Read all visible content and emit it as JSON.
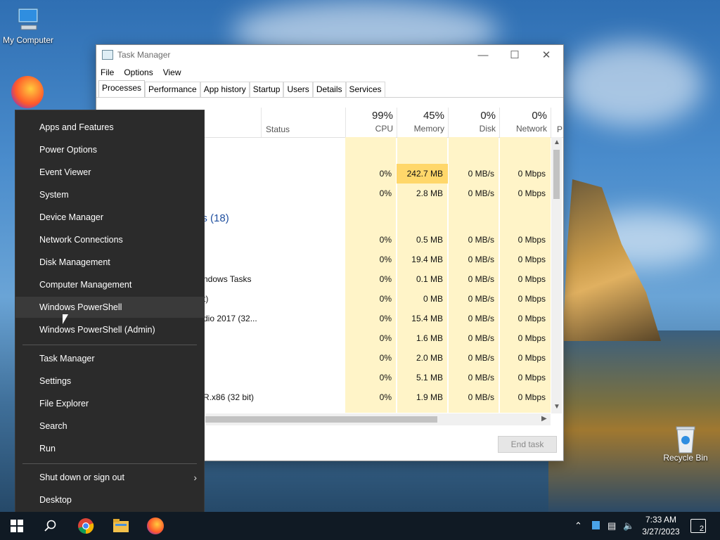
{
  "desktop": {
    "icons": [
      {
        "label": "My Computer"
      },
      {
        "label": "Recycle Bin"
      }
    ]
  },
  "task_manager": {
    "title": "Task Manager",
    "menu": [
      "File",
      "Options",
      "View"
    ],
    "tabs": [
      "Processes",
      "Performance",
      "App history",
      "Startup",
      "Users",
      "Details",
      "Services"
    ],
    "active_tab": "Processes",
    "columns": {
      "status": "Status",
      "cpu": {
        "pct": "99%",
        "label": "CPU"
      },
      "memory": {
        "pct": "45%",
        "label": "Memory"
      },
      "disk": {
        "pct": "0%",
        "label": "Disk"
      },
      "network": {
        "pct": "0%",
        "label": "Network"
      },
      "power_partial": "P"
    },
    "group_label_partial": "es (18)",
    "rows": [
      {
        "name": "",
        "cpu": "0%",
        "memory": "242.7 MB",
        "disk": "0 MB/s",
        "network": "0 Mbps"
      },
      {
        "name": "",
        "cpu": "0%",
        "memory": "2.8 MB",
        "disk": "0 MB/s",
        "network": "0 Mbps"
      },
      {
        "name": "",
        "cpu": "0%",
        "memory": "0.5 MB",
        "disk": "0 MB/s",
        "network": "0 Mbps"
      },
      {
        "name": "",
        "cpu": "0%",
        "memory": "19.4 MB",
        "disk": "0 MB/s",
        "network": "0 Mbps"
      },
      {
        "name": "ndows Tasks",
        "cpu": "0%",
        "memory": "0.1 MB",
        "disk": "0 MB/s",
        "network": "0 Mbps"
      },
      {
        "name": "t)",
        "cpu": "0%",
        "memory": "0 MB",
        "disk": "0 MB/s",
        "network": "0 Mbps"
      },
      {
        "name": "dio 2017 (32...",
        "cpu": "0%",
        "memory": "15.4 MB",
        "disk": "0 MB/s",
        "network": "0 Mbps"
      },
      {
        "name": "",
        "cpu": "0%",
        "memory": "1.6 MB",
        "disk": "0 MB/s",
        "network": "0 Mbps"
      },
      {
        "name": "",
        "cpu": "0%",
        "memory": "2.0 MB",
        "disk": "0 MB/s",
        "network": "0 Mbps"
      },
      {
        "name": "",
        "cpu": "0%",
        "memory": "5.1 MB",
        "disk": "0 MB/s",
        "network": "0 Mbps"
      },
      {
        "name": "R.x86 (32 bit)",
        "cpu": "0%",
        "memory": "1.9 MB",
        "disk": "0 MB/s",
        "network": "0 Mbps"
      }
    ],
    "end_task": "End task"
  },
  "winx_menu": {
    "items": [
      "Apps and Features",
      "Power Options",
      "Event Viewer",
      "System",
      "Device Manager",
      "Network Connections",
      "Disk Management",
      "Computer Management",
      "Windows PowerShell",
      "Windows PowerShell (Admin)",
      "Task Manager",
      "Settings",
      "File Explorer",
      "Search",
      "Run",
      "Shut down or sign out",
      "Desktop"
    ],
    "highlighted": "Windows PowerShell"
  },
  "taskbar": {
    "time": "7:33 AM",
    "date": "3/27/2023",
    "notification_count": "2"
  },
  "colors": {
    "menu_bg": "#2b2b2b",
    "heat_cell": "#fff4c8",
    "heat_cell_strong": "#ffd76a",
    "taskbar": "#101a24"
  }
}
